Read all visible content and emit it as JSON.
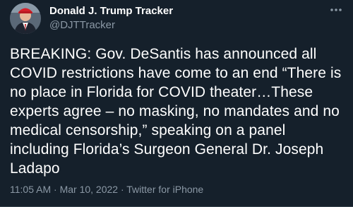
{
  "tweet": {
    "author": {
      "display_name": "Donald J. Trump Tracker",
      "handle": "@DJTTracker",
      "avatar_icon": "profile-photo-icon"
    },
    "more_icon": "more-options-icon",
    "text": "BREAKING: Gov. DeSantis has announced all COVID restrictions have come to an end “There is no place in Florida for COVID theater…These experts agree – no masking, no mandates and no medical censorship,” speaking on a panel including Florida’s Surgeon General Dr. Joseph Ladapo",
    "meta": {
      "time": "11:05 AM",
      "separator": "·",
      "date": "Mar 10, 2022",
      "source": "Twitter for iPhone"
    }
  },
  "colors": {
    "background": "#15202b",
    "text_primary": "#ffffff",
    "text_secondary": "#8b98a5",
    "border": "#38444d"
  }
}
